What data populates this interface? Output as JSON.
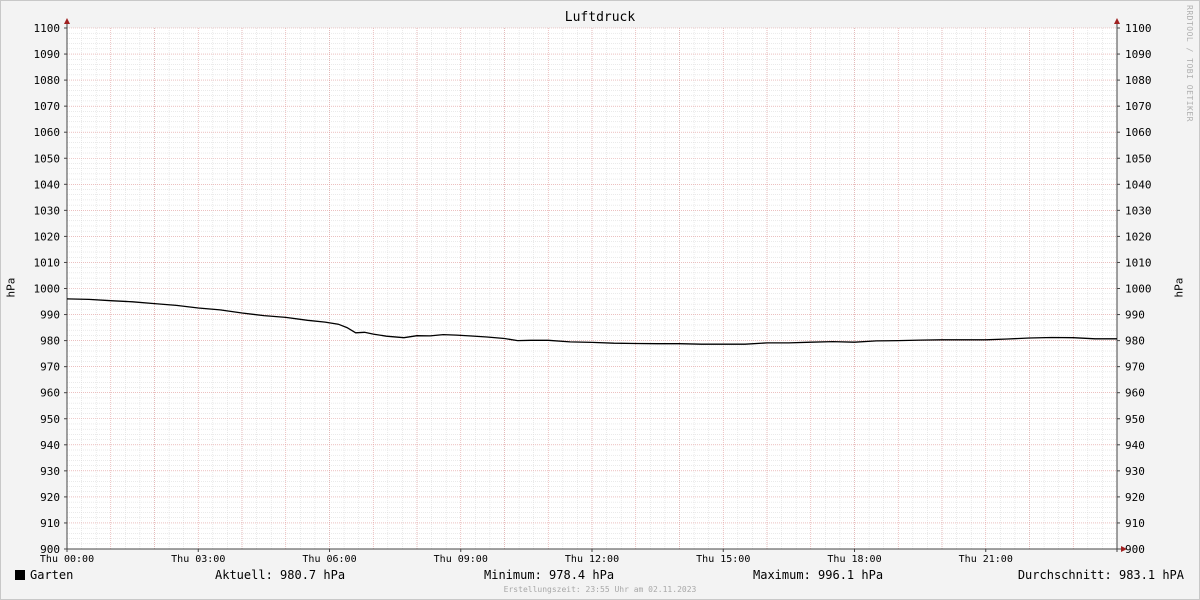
{
  "chart_data": {
    "type": "line",
    "title": "Luftdruck",
    "ylabel": "hPa",
    "ylim": [
      900,
      1100
    ],
    "yticks": [
      900,
      910,
      920,
      930,
      940,
      950,
      960,
      970,
      980,
      990,
      1000,
      1010,
      1020,
      1030,
      1040,
      1050,
      1060,
      1070,
      1080,
      1090,
      1100
    ],
    "xlim": [
      0,
      24
    ],
    "xticks": [
      {
        "hour": 0,
        "label": "Thu 00:00"
      },
      {
        "hour": 3,
        "label": "Thu 03:00"
      },
      {
        "hour": 6,
        "label": "Thu 06:00"
      },
      {
        "hour": 9,
        "label": "Thu 09:00"
      },
      {
        "hour": 12,
        "label": "Thu 12:00"
      },
      {
        "hour": 15,
        "label": "Thu 15:00"
      },
      {
        "hour": 18,
        "label": "Thu 18:00"
      },
      {
        "hour": 21,
        "label": "Thu 21:00"
      }
    ],
    "grid": true,
    "series": [
      {
        "name": "Garten",
        "color": "#000000",
        "x": [
          0,
          0.5,
          1,
          1.5,
          2,
          2.5,
          3,
          3.5,
          4,
          4.5,
          5,
          5.5,
          5.9,
          6.2,
          6.4,
          6.6,
          6.8,
          7,
          7.3,
          7.7,
          8,
          8.3,
          8.6,
          8.9,
          9.2,
          9.6,
          10,
          10.3,
          10.6,
          11,
          11.5,
          12,
          12.5,
          13,
          13.5,
          14,
          14.5,
          15,
          15.5,
          16,
          16.5,
          17,
          17.5,
          18,
          18.5,
          19,
          19.5,
          20,
          20.5,
          21,
          21.5,
          22,
          22.5,
          23,
          23.5,
          24
        ],
        "values": [
          996,
          995.8,
          995.3,
          994.9,
          994.2,
          993.5,
          992.5,
          991.8,
          990.6,
          989.6,
          988.9,
          987.8,
          987.1,
          986.3,
          985,
          983,
          983.2,
          982.5,
          981.7,
          981.1,
          981.9,
          981.8,
          982.3,
          982.1,
          981.8,
          981.4,
          980.8,
          980,
          980.1,
          980.1,
          979.5,
          979.3,
          979,
          978.9,
          978.8,
          978.8,
          978.6,
          978.6,
          978.6,
          979.1,
          979.1,
          979.4,
          979.6,
          979.4,
          979.9,
          980,
          980.2,
          980.3,
          980.3,
          980.3,
          980.6,
          981,
          981.2,
          981.1,
          980.7,
          980.7
        ]
      }
    ]
  },
  "axis_label_left": "hPa",
  "axis_label_right": "hPa",
  "watermark": "RRDTOOL / TOBI OETIKER",
  "legend": {
    "series_name": "Garten",
    "current": "Aktuell: 980.7 hPa",
    "minimum": "Minimum: 978.4 hPa",
    "maximum": "Maximum: 996.1 hPa",
    "average": "Durchschnitt: 983.1 hPA"
  },
  "footer": "Erstellungszeit: 23:55 Uhr am 02.11.2023"
}
